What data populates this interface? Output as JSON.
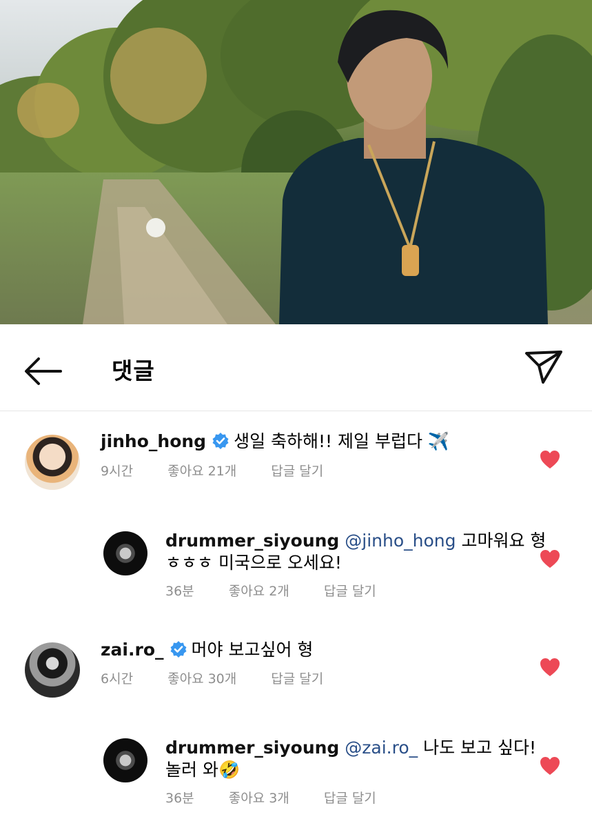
{
  "header": {
    "title": "댓글"
  },
  "comments": [
    {
      "username": "jinho_hong",
      "verified": true,
      "text": "생일 축하해!! 제일 부럽다 ✈️",
      "time": "9시간",
      "likes": "좋아요 21개",
      "reply_label": "답글 달기",
      "liked": true
    },
    {
      "username": "drummer_siyoung",
      "mention": "@jinho_hong",
      "text_line1": "고마워요 형",
      "text_line2": "ㅎㅎㅎ 미국으로 오세요!",
      "time": "36분",
      "likes": "좋아요 2개",
      "reply_label": "답글 달기",
      "liked": true
    },
    {
      "username": "zai.ro_",
      "verified": true,
      "text": "머야 보고싶어 형",
      "time": "6시간",
      "likes": "좋아요 30개",
      "reply_label": "답글 달기",
      "liked": true
    },
    {
      "username": "drummer_siyoung",
      "mention": "@zai.ro_",
      "text_line1": "나도 보고 싶다!",
      "text_line2": "놀러 와🤣",
      "time": "36분",
      "likes": "좋아요 3개",
      "reply_label": "답글 달기",
      "liked": true
    }
  ],
  "colors": {
    "heart": "#ed4956",
    "verified": "#3897f0",
    "mention": "#2a4f88",
    "meta": "#8e8e8e"
  }
}
